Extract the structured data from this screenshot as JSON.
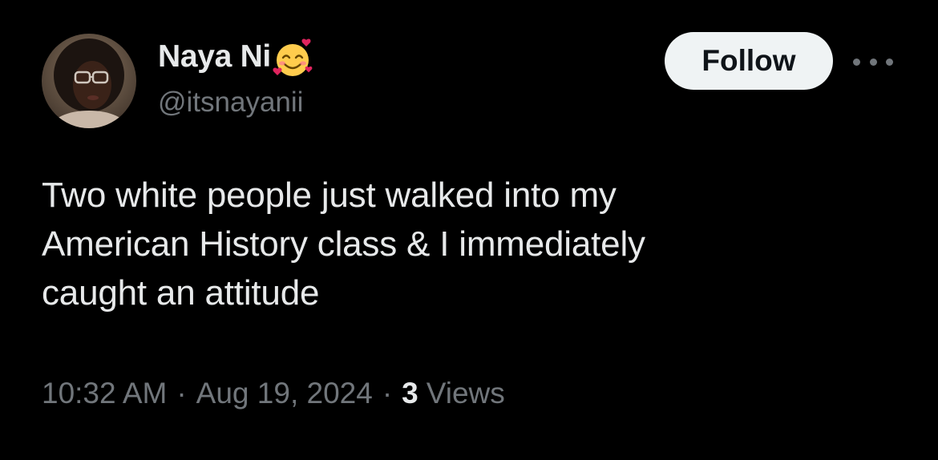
{
  "user": {
    "display_name": "Naya Ni",
    "emoji": "smiling-face-with-hearts",
    "handle": "@itsnayanii"
  },
  "actions": {
    "follow_label": "Follow",
    "more_icon": "more-horizontal-icon"
  },
  "tweet": {
    "lines": [
      "Two white people just walked into my",
      "American History class & I immediately",
      "caught an attitude"
    ]
  },
  "meta": {
    "time": "10:32 AM",
    "separator": "·",
    "date": "Aug 19, 2024",
    "views_count": "3",
    "views_label": "Views"
  },
  "colors": {
    "background": "#000000",
    "primary_text": "#e7e9ea",
    "secondary_text": "#71767b",
    "follow_button_bg": "#eff3f4",
    "follow_button_text": "#0f1419"
  }
}
